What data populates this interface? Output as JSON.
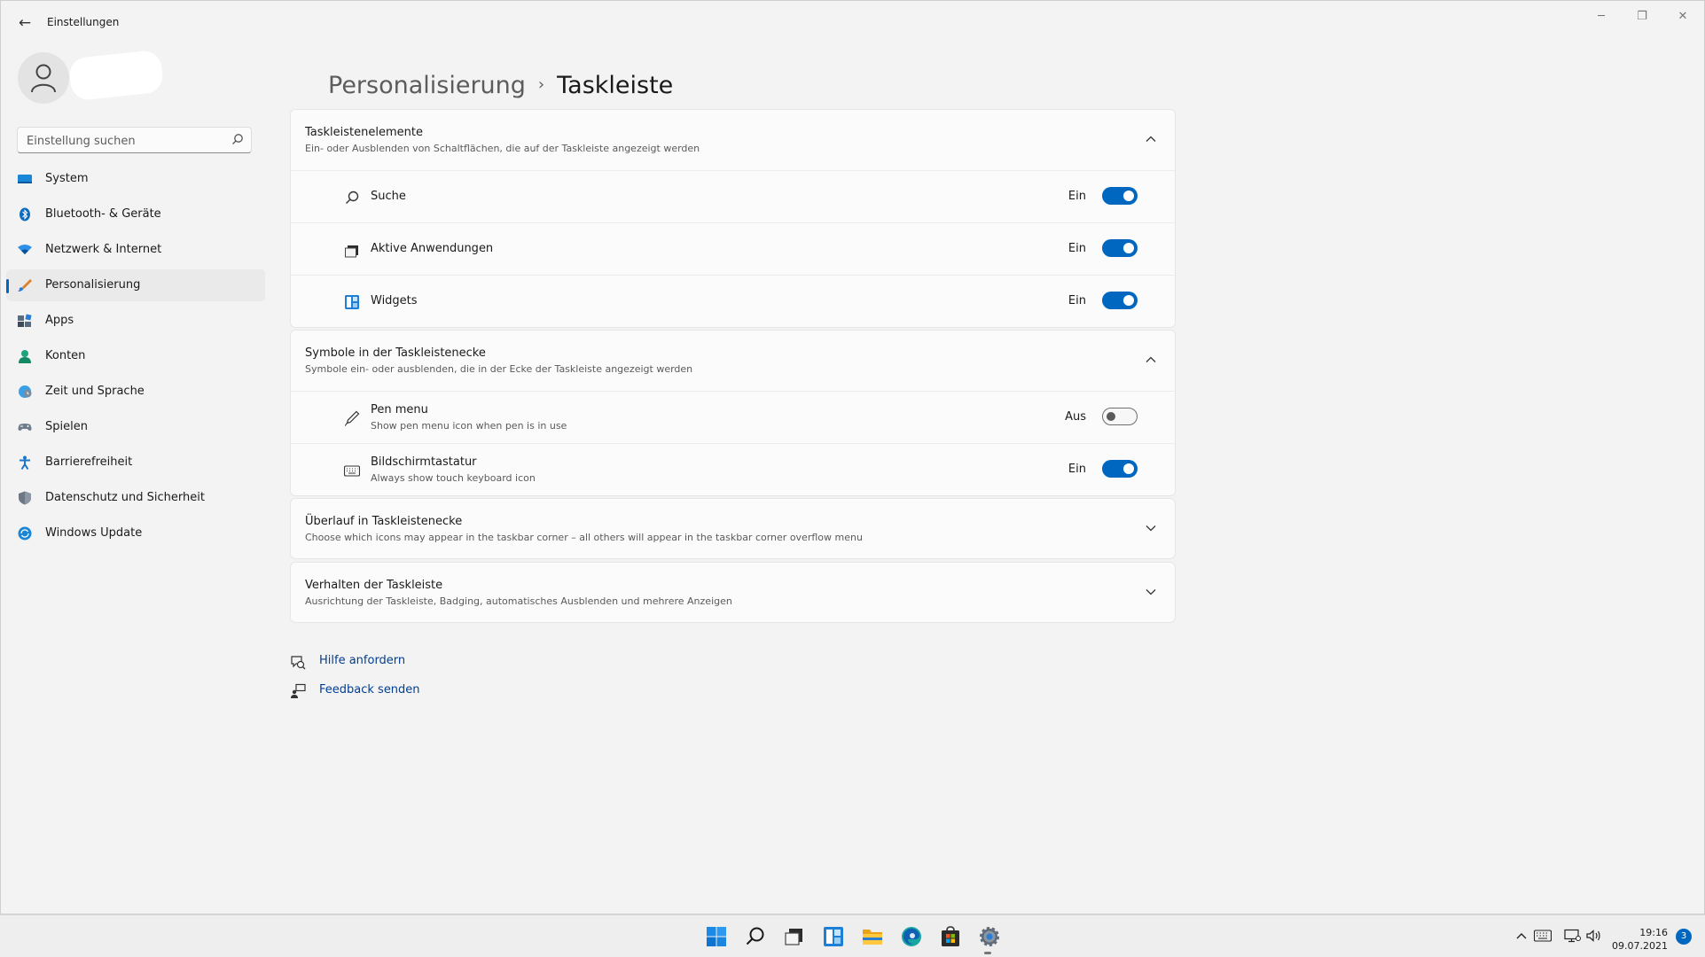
{
  "window": {
    "title": "Einstellungen",
    "back_icon": "back-arrow-icon",
    "controls": [
      "minimize-icon",
      "restore-icon",
      "close-icon"
    ]
  },
  "sidebar": {
    "user": {
      "name": "",
      "subtitle": ""
    },
    "search": {
      "placeholder": "Einstellung suchen",
      "icon": "search-icon"
    },
    "items": [
      {
        "label": "System",
        "icon": "system-icon",
        "active": false
      },
      {
        "label": "Bluetooth- & Geräte",
        "icon": "bluetooth-icon",
        "active": false
      },
      {
        "label": "Netzwerk & Internet",
        "icon": "network-icon",
        "active": false
      },
      {
        "label": "Personalisierung",
        "icon": "personalization-brush-icon",
        "active": true
      },
      {
        "label": "Apps",
        "icon": "apps-icon",
        "active": false
      },
      {
        "label": "Konten",
        "icon": "accounts-icon",
        "active": false
      },
      {
        "label": "Zeit und Sprache",
        "icon": "time-language-icon",
        "active": false
      },
      {
        "label": "Spielen",
        "icon": "gaming-icon",
        "active": false
      },
      {
        "label": "Barrierefreiheit",
        "icon": "accessibility-icon",
        "active": false
      },
      {
        "label": "Datenschutz und Sicherheit",
        "icon": "privacy-shield-icon",
        "active": false
      },
      {
        "label": "Windows Update",
        "icon": "windows-update-icon",
        "active": false
      }
    ]
  },
  "breadcrumb": {
    "parent": "Personalisierung",
    "separator": "›",
    "current": "Taskleiste"
  },
  "sections": [
    {
      "title": "Taskleistenelemente",
      "description": "Ein- oder Ausblenden von Schaltflächen, die auf der Taskleiste angezeigt werden",
      "expanded": true,
      "items": [
        {
          "label": "Suche",
          "icon": "search-icon",
          "state": "Ein",
          "on": true
        },
        {
          "label": "Aktive Anwendungen",
          "icon": "task-view-icon",
          "state": "Ein",
          "on": true
        },
        {
          "label": "Widgets",
          "icon": "widgets-icon",
          "state": "Ein",
          "on": true
        }
      ]
    },
    {
      "title": "Symbole in der Taskleistenecke",
      "description": "Symbole ein- oder ausblenden, die in der Ecke der Taskleiste angezeigt werden",
      "expanded": true,
      "items": [
        {
          "label": "Pen menu",
          "sub": "Show pen menu icon when pen is in use",
          "icon": "pen-icon",
          "state": "Aus",
          "on": false
        },
        {
          "label": "Bildschirmtastatur",
          "sub": "Always show touch keyboard icon",
          "icon": "keyboard-icon",
          "state": "Ein",
          "on": true
        }
      ]
    },
    {
      "title": "Überlauf in Taskleistenecke",
      "description": "Choose which icons may appear in the taskbar corner – all others will appear in the taskbar corner overflow menu",
      "expanded": false
    },
    {
      "title": "Verhalten der Taskleiste",
      "description": "Ausrichtung der Taskleiste, Badging, automatisches Ausblenden und mehrere Anzeigen",
      "expanded": false
    }
  ],
  "links": [
    {
      "label": "Hilfe anfordern",
      "icon": "help-icon"
    },
    {
      "label": "Feedback senden",
      "icon": "feedback-icon"
    }
  ],
  "taskbar": {
    "apps": [
      "start-icon",
      "search-icon",
      "task-view-icon",
      "widgets-icon",
      "file-explorer-icon",
      "edge-icon",
      "store-icon",
      "settings-gear-icon"
    ],
    "tray": [
      "chevron-up-icon",
      "keyboard-icon",
      "network-icon",
      "volume-icon"
    ],
    "time": "19:16",
    "date": "09.07.2021",
    "notification_count": "3"
  },
  "colors": {
    "accent": "#0067c0",
    "background": "#f3f3f3",
    "card": "#fbfbfb",
    "link": "#003e92"
  }
}
